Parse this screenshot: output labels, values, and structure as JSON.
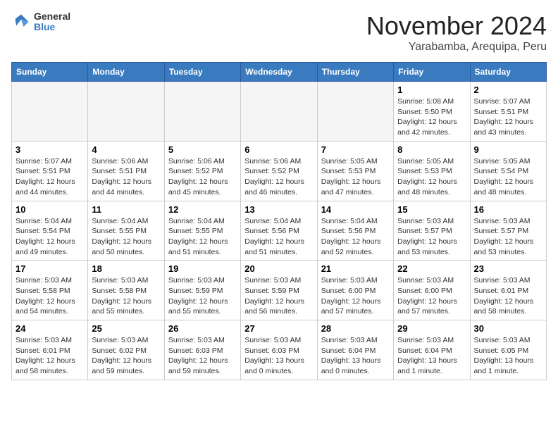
{
  "header": {
    "logo": {
      "general": "General",
      "blue": "Blue"
    },
    "title": "November 2024",
    "location": "Yarabamba, Arequipa, Peru"
  },
  "weekdays": [
    "Sunday",
    "Monday",
    "Tuesday",
    "Wednesday",
    "Thursday",
    "Friday",
    "Saturday"
  ],
  "weeks": [
    [
      {
        "day": "",
        "info": ""
      },
      {
        "day": "",
        "info": ""
      },
      {
        "day": "",
        "info": ""
      },
      {
        "day": "",
        "info": ""
      },
      {
        "day": "",
        "info": ""
      },
      {
        "day": "1",
        "info": "Sunrise: 5:08 AM\nSunset: 5:50 PM\nDaylight: 12 hours\nand 42 minutes."
      },
      {
        "day": "2",
        "info": "Sunrise: 5:07 AM\nSunset: 5:51 PM\nDaylight: 12 hours\nand 43 minutes."
      }
    ],
    [
      {
        "day": "3",
        "info": "Sunrise: 5:07 AM\nSunset: 5:51 PM\nDaylight: 12 hours\nand 44 minutes."
      },
      {
        "day": "4",
        "info": "Sunrise: 5:06 AM\nSunset: 5:51 PM\nDaylight: 12 hours\nand 44 minutes."
      },
      {
        "day": "5",
        "info": "Sunrise: 5:06 AM\nSunset: 5:52 PM\nDaylight: 12 hours\nand 45 minutes."
      },
      {
        "day": "6",
        "info": "Sunrise: 5:06 AM\nSunset: 5:52 PM\nDaylight: 12 hours\nand 46 minutes."
      },
      {
        "day": "7",
        "info": "Sunrise: 5:05 AM\nSunset: 5:53 PM\nDaylight: 12 hours\nand 47 minutes."
      },
      {
        "day": "8",
        "info": "Sunrise: 5:05 AM\nSunset: 5:53 PM\nDaylight: 12 hours\nand 48 minutes."
      },
      {
        "day": "9",
        "info": "Sunrise: 5:05 AM\nSunset: 5:54 PM\nDaylight: 12 hours\nand 48 minutes."
      }
    ],
    [
      {
        "day": "10",
        "info": "Sunrise: 5:04 AM\nSunset: 5:54 PM\nDaylight: 12 hours\nand 49 minutes."
      },
      {
        "day": "11",
        "info": "Sunrise: 5:04 AM\nSunset: 5:55 PM\nDaylight: 12 hours\nand 50 minutes."
      },
      {
        "day": "12",
        "info": "Sunrise: 5:04 AM\nSunset: 5:55 PM\nDaylight: 12 hours\nand 51 minutes."
      },
      {
        "day": "13",
        "info": "Sunrise: 5:04 AM\nSunset: 5:56 PM\nDaylight: 12 hours\nand 51 minutes."
      },
      {
        "day": "14",
        "info": "Sunrise: 5:04 AM\nSunset: 5:56 PM\nDaylight: 12 hours\nand 52 minutes."
      },
      {
        "day": "15",
        "info": "Sunrise: 5:03 AM\nSunset: 5:57 PM\nDaylight: 12 hours\nand 53 minutes."
      },
      {
        "day": "16",
        "info": "Sunrise: 5:03 AM\nSunset: 5:57 PM\nDaylight: 12 hours\nand 53 minutes."
      }
    ],
    [
      {
        "day": "17",
        "info": "Sunrise: 5:03 AM\nSunset: 5:58 PM\nDaylight: 12 hours\nand 54 minutes."
      },
      {
        "day": "18",
        "info": "Sunrise: 5:03 AM\nSunset: 5:58 PM\nDaylight: 12 hours\nand 55 minutes."
      },
      {
        "day": "19",
        "info": "Sunrise: 5:03 AM\nSunset: 5:59 PM\nDaylight: 12 hours\nand 55 minutes."
      },
      {
        "day": "20",
        "info": "Sunrise: 5:03 AM\nSunset: 5:59 PM\nDaylight: 12 hours\nand 56 minutes."
      },
      {
        "day": "21",
        "info": "Sunrise: 5:03 AM\nSunset: 6:00 PM\nDaylight: 12 hours\nand 57 minutes."
      },
      {
        "day": "22",
        "info": "Sunrise: 5:03 AM\nSunset: 6:00 PM\nDaylight: 12 hours\nand 57 minutes."
      },
      {
        "day": "23",
        "info": "Sunrise: 5:03 AM\nSunset: 6:01 PM\nDaylight: 12 hours\nand 58 minutes."
      }
    ],
    [
      {
        "day": "24",
        "info": "Sunrise: 5:03 AM\nSunset: 6:01 PM\nDaylight: 12 hours\nand 58 minutes."
      },
      {
        "day": "25",
        "info": "Sunrise: 5:03 AM\nSunset: 6:02 PM\nDaylight: 12 hours\nand 59 minutes."
      },
      {
        "day": "26",
        "info": "Sunrise: 5:03 AM\nSunset: 6:03 PM\nDaylight: 12 hours\nand 59 minutes."
      },
      {
        "day": "27",
        "info": "Sunrise: 5:03 AM\nSunset: 6:03 PM\nDaylight: 13 hours\nand 0 minutes."
      },
      {
        "day": "28",
        "info": "Sunrise: 5:03 AM\nSunset: 6:04 PM\nDaylight: 13 hours\nand 0 minutes."
      },
      {
        "day": "29",
        "info": "Sunrise: 5:03 AM\nSunset: 6:04 PM\nDaylight: 13 hours\nand 1 minute."
      },
      {
        "day": "30",
        "info": "Sunrise: 5:03 AM\nSunset: 6:05 PM\nDaylight: 13 hours\nand 1 minute."
      }
    ]
  ]
}
